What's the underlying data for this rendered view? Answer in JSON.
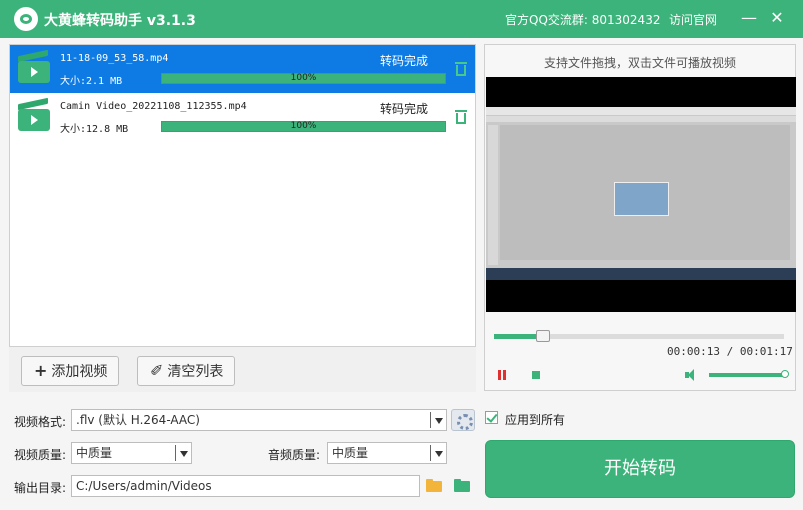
{
  "window": {
    "title": "大黄蜂转码助手 v3.1.3",
    "qq_group": "官方QQ交流群: 801302432",
    "visit_site": "访问官网",
    "minimize": "—",
    "close": "✕"
  },
  "files": [
    {
      "name": "11-18-09_53_58.mp4",
      "size": "大小:2.1 MB",
      "status": "转码完成",
      "progress_text": "100%",
      "progress_value": 100,
      "selected": true
    },
    {
      "name": "Camin Video_20221108_112355.mp4",
      "size": "大小:12.8 MB",
      "status": "转码完成",
      "progress_text": "100%",
      "progress_value": 100,
      "selected": false
    }
  ],
  "list_toolbar": {
    "add_label": "添加视频",
    "clear_label": "清空列表"
  },
  "preview": {
    "hint": "支持文件拖拽，双击文件可播放视频",
    "time": "00:00:13 / 00:01:17",
    "seek_fraction": 0.17,
    "volume_fraction": 1.0
  },
  "settings": {
    "format_label": "视频格式:",
    "format_value": ".flv (默认 H.264-AAC)",
    "video_quality_label": "视频质量:",
    "video_quality_value": "中质量",
    "audio_quality_label": "音频质量:",
    "audio_quality_value": "中质量",
    "output_label": "输出目录:",
    "output_value": "C:/Users/admin/Videos",
    "apply_all_label": "应用到所有",
    "apply_all_checked": true
  },
  "start_button": "开始转码",
  "colors": {
    "accent": "#3cb37a",
    "selected_row": "#0e7be4",
    "pause": "#e03030",
    "folder_yellow": "#f2b43a"
  }
}
